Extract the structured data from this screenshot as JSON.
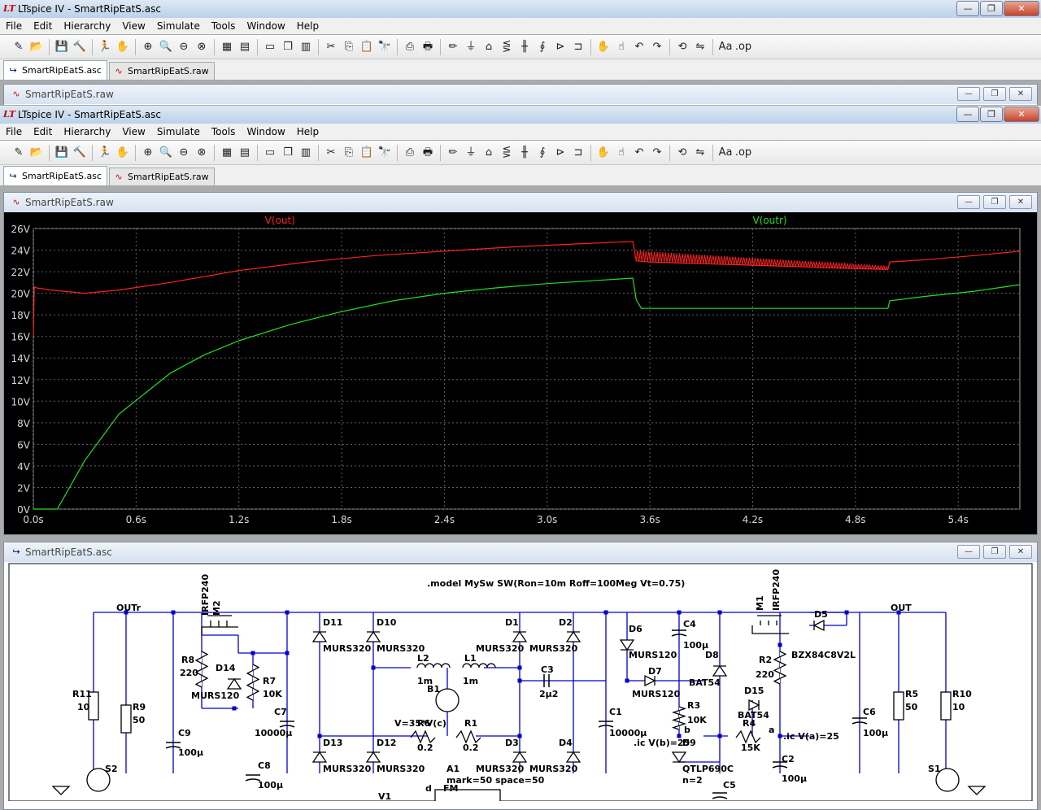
{
  "app": {
    "title1": "LTspice IV - SmartRipEatS.asc",
    "title2": "LTspice IV - SmartRipEatS.asc"
  },
  "menu": [
    "File",
    "Edit",
    "Hierarchy",
    "View",
    "Simulate",
    "Tools",
    "Window",
    "Help"
  ],
  "toolbar_icons": [
    "new-schematic-icon",
    "open-icon",
    "save-icon",
    "control-panel-icon",
    "run-icon",
    "halt-icon",
    "zoom-in-icon",
    "zoom-area-icon",
    "zoom-out-icon",
    "zoom-fit-icon",
    "autorange-icon",
    "view-icon",
    "tile-horizontal-icon",
    "cascade-icon",
    "tile-vertical-icon",
    "cut-icon",
    "copy-icon",
    "paste-icon",
    "find-icon",
    "print-setup-icon",
    "print-icon",
    "draw-wire-icon",
    "ground-icon",
    "label-icon",
    "resistor-icon",
    "capacitor-icon",
    "inductor-icon",
    "diode-icon",
    "component-icon",
    "move-icon",
    "drag-icon",
    "undo-icon",
    "redo-icon",
    "rotate-icon",
    "mirror-icon",
    "text-icon",
    "spice-directive-icon"
  ],
  "tabs": [
    {
      "label": "SmartRipEatS.asc",
      "icon": "schematic-tab-icon"
    },
    {
      "label": "SmartRipEatS.raw",
      "icon": "waveform-tab-icon"
    }
  ],
  "windows": {
    "raw_min_title": "SmartRipEatS.raw",
    "plot_title": "SmartRipEatS.raw",
    "schematic_title": "SmartRipEatS.asc"
  },
  "colors": {
    "vout": "#ff2020",
    "voutr": "#20e020",
    "plot_bg": "#000000",
    "grid": "#606060",
    "wire": "#0000cc"
  },
  "chart_data": {
    "type": "line",
    "title": "",
    "xlabel": "",
    "ylabel": "",
    "xlim": [
      0,
      5.76
    ],
    "ylim": [
      0,
      26
    ],
    "x_ticks": [
      "0.0s",
      "0.6s",
      "1.2s",
      "1.8s",
      "2.4s",
      "3.0s",
      "3.6s",
      "4.2s",
      "4.8s",
      "5.4s"
    ],
    "y_ticks": [
      "0V",
      "2V",
      "4V",
      "6V",
      "8V",
      "10V",
      "12V",
      "14V",
      "16V",
      "18V",
      "20V",
      "22V",
      "24V",
      "26V"
    ],
    "grid": true,
    "legend": "top",
    "series": [
      {
        "name": "V(out)",
        "x": [
          0.0,
          0.005,
          0.02,
          0.1,
          0.3,
          0.5,
          0.8,
          1.2,
          1.6,
          2.0,
          2.4,
          2.8,
          3.2,
          3.5,
          3.52,
          3.6,
          3.8,
          4.0,
          4.2,
          4.4,
          4.6,
          4.8,
          4.99,
          5.0,
          5.2,
          5.5,
          5.76
        ],
        "y": [
          16.0,
          20.6,
          20.5,
          20.3,
          20.0,
          20.3,
          21.0,
          22.1,
          22.9,
          23.5,
          23.9,
          24.3,
          24.6,
          24.8,
          23.0,
          22.9,
          22.8,
          22.7,
          22.6,
          22.5,
          22.4,
          22.3,
          22.2,
          22.9,
          23.1,
          23.5,
          23.9
        ]
      },
      {
        "name": "V(outr)",
        "x": [
          0.0,
          0.14,
          0.3,
          0.5,
          0.8,
          1.0,
          1.2,
          1.5,
          1.8,
          2.1,
          2.4,
          2.7,
          3.0,
          3.3,
          3.5,
          3.52,
          3.55,
          3.8,
          4.2,
          4.6,
          4.99,
          5.0,
          5.2,
          5.5,
          5.76
        ],
        "y": [
          0.0,
          0.0,
          4.5,
          8.8,
          12.6,
          14.3,
          15.6,
          17.1,
          18.3,
          19.3,
          20.0,
          20.5,
          20.9,
          21.2,
          21.4,
          19.4,
          18.6,
          18.6,
          18.6,
          18.6,
          18.6,
          19.3,
          19.7,
          20.2,
          20.8
        ]
      }
    ],
    "ripple": {
      "series": "V(out)",
      "x_start": 3.52,
      "x_end": 4.99,
      "amplitude_start": 1.0,
      "amplitude_end": 0.3
    }
  },
  "schematic": {
    "directive": ".model MySw SW(Ron=10m Roff=100Meg Vt=0.75)",
    "labels": [
      {
        "name": "m2-name",
        "text": "M2"
      },
      {
        "name": "m2-model",
        "text": "IRFP240"
      },
      {
        "name": "m1-name",
        "text": "M1"
      },
      {
        "name": "m1-model",
        "text": "IRFP240"
      },
      {
        "name": "outr-net",
        "text": "OUTr"
      },
      {
        "name": "out-net",
        "text": "OUT"
      },
      {
        "name": "r8-name",
        "text": "R8"
      },
      {
        "name": "r8-value",
        "text": "220"
      },
      {
        "name": "d14-name",
        "text": "D14"
      },
      {
        "name": "d14-model",
        "text": "MURS120"
      },
      {
        "name": "r7-name",
        "text": "R7"
      },
      {
        "name": "r7-value",
        "text": "10K"
      },
      {
        "name": "c7-name",
        "text": "C7"
      },
      {
        "name": "c7-value",
        "text": "10000µ"
      },
      {
        "name": "c8-name",
        "text": "C8"
      },
      {
        "name": "c8-value",
        "text": "100µ"
      },
      {
        "name": "c9-name",
        "text": "C9"
      },
      {
        "name": "c9-value",
        "text": "100µ"
      },
      {
        "name": "r11-name",
        "text": "R11"
      },
      {
        "name": "r11-value",
        "text": "10"
      },
      {
        "name": "r9-name",
        "text": "R9"
      },
      {
        "name": "r9-value",
        "text": "50"
      },
      {
        "name": "s2-name",
        "text": "S2"
      },
      {
        "name": "d11-name",
        "text": "D11"
      },
      {
        "name": "d11-model",
        "text": "MURS320"
      },
      {
        "name": "d10-name",
        "text": "D10"
      },
      {
        "name": "d10-model",
        "text": "MURS320"
      },
      {
        "name": "d13-name",
        "text": "D13"
      },
      {
        "name": "d13-model",
        "text": "MURS320"
      },
      {
        "name": "d12-name",
        "text": "D12"
      },
      {
        "name": "d12-model",
        "text": "MURS320"
      },
      {
        "name": "l2-name",
        "text": "L2"
      },
      {
        "name": "l2-value",
        "text": "1m"
      },
      {
        "name": "l1-name",
        "text": "L1"
      },
      {
        "name": "l1-value",
        "text": "1m"
      },
      {
        "name": "b1-name",
        "text": "B1"
      },
      {
        "name": "b1-expr",
        "text": "V=35*V(c)"
      },
      {
        "name": "r6-name",
        "text": "R6"
      },
      {
        "name": "r6-value",
        "text": "0.2"
      },
      {
        "name": "r1-name",
        "text": "R1"
      },
      {
        "name": "r1-value",
        "text": "0.2"
      },
      {
        "name": "a1-name",
        "text": "A1"
      },
      {
        "name": "a1-params",
        "text": "mark=50 space=50"
      },
      {
        "name": "v1-name",
        "text": "V1"
      },
      {
        "name": "a1-pin-d",
        "text": "d"
      },
      {
        "name": "a1-pin-fm",
        "text": "FM"
      },
      {
        "name": "d1-name",
        "text": "D1"
      },
      {
        "name": "d1-model",
        "text": "MURS320"
      },
      {
        "name": "d2-name",
        "text": "D2"
      },
      {
        "name": "d2-model",
        "text": "MURS320"
      },
      {
        "name": "d3-name",
        "text": "D3"
      },
      {
        "name": "d3-model",
        "text": "MURS320"
      },
      {
        "name": "d4-name",
        "text": "D4"
      },
      {
        "name": "d4-model",
        "text": "MURS320"
      },
      {
        "name": "c3-name",
        "text": "C3"
      },
      {
        "name": "c3-value",
        "text": "2µ2"
      },
      {
        "name": "c1-name",
        "text": "C1"
      },
      {
        "name": "c1-value",
        "text": "10000µ"
      },
      {
        "name": "d6-name",
        "text": "D6"
      },
      {
        "name": "d6-model",
        "text": "MURS120"
      },
      {
        "name": "c4-name",
        "text": "C4"
      },
      {
        "name": "c4-value",
        "text": "100µ"
      },
      {
        "name": "d7-name",
        "text": "D7"
      },
      {
        "name": "d7-model",
        "text": "MURS120"
      },
      {
        "name": "d8-name",
        "text": "D8"
      },
      {
        "name": "d8-model",
        "text": "BAT54"
      },
      {
        "name": "r3-name",
        "text": "R3"
      },
      {
        "name": "r3-value",
        "text": "10K"
      },
      {
        "name": "ic-vb",
        "text": ".ic V(b)=25"
      },
      {
        "name": "net-b",
        "text": "b"
      },
      {
        "name": "d9-name",
        "text": "D9"
      },
      {
        "name": "d9-model",
        "text": "QTLP690C"
      },
      {
        "name": "n2",
        "text": "n=2"
      },
      {
        "name": "c5-name",
        "text": "C5"
      },
      {
        "name": "d15-name",
        "text": "D15"
      },
      {
        "name": "d15-model",
        "text": "BAT54"
      },
      {
        "name": "r4-name",
        "text": "R4"
      },
      {
        "name": "r4-value",
        "text": "15K"
      },
      {
        "name": "net-a",
        "text": "a"
      },
      {
        "name": "ic-va",
        "text": ".ic V(a)=25"
      },
      {
        "name": "c2-name",
        "text": "C2"
      },
      {
        "name": "c2-value",
        "text": "100µ"
      },
      {
        "name": "r2-name",
        "text": "R2"
      },
      {
        "name": "r2-value",
        "text": "220"
      },
      {
        "name": "d5-name",
        "text": "D5"
      },
      {
        "name": "d5-model",
        "text": "BZX84C8V2L"
      },
      {
        "name": "c6-name",
        "text": "C6"
      },
      {
        "name": "c6-value",
        "text": "100µ"
      },
      {
        "name": "r5-name",
        "text": "R5"
      },
      {
        "name": "r5-value",
        "text": "50"
      },
      {
        "name": "r10-name",
        "text": "R10"
      },
      {
        "name": "r10-value",
        "text": "10"
      },
      {
        "name": "s1-name",
        "text": "S1"
      }
    ]
  }
}
